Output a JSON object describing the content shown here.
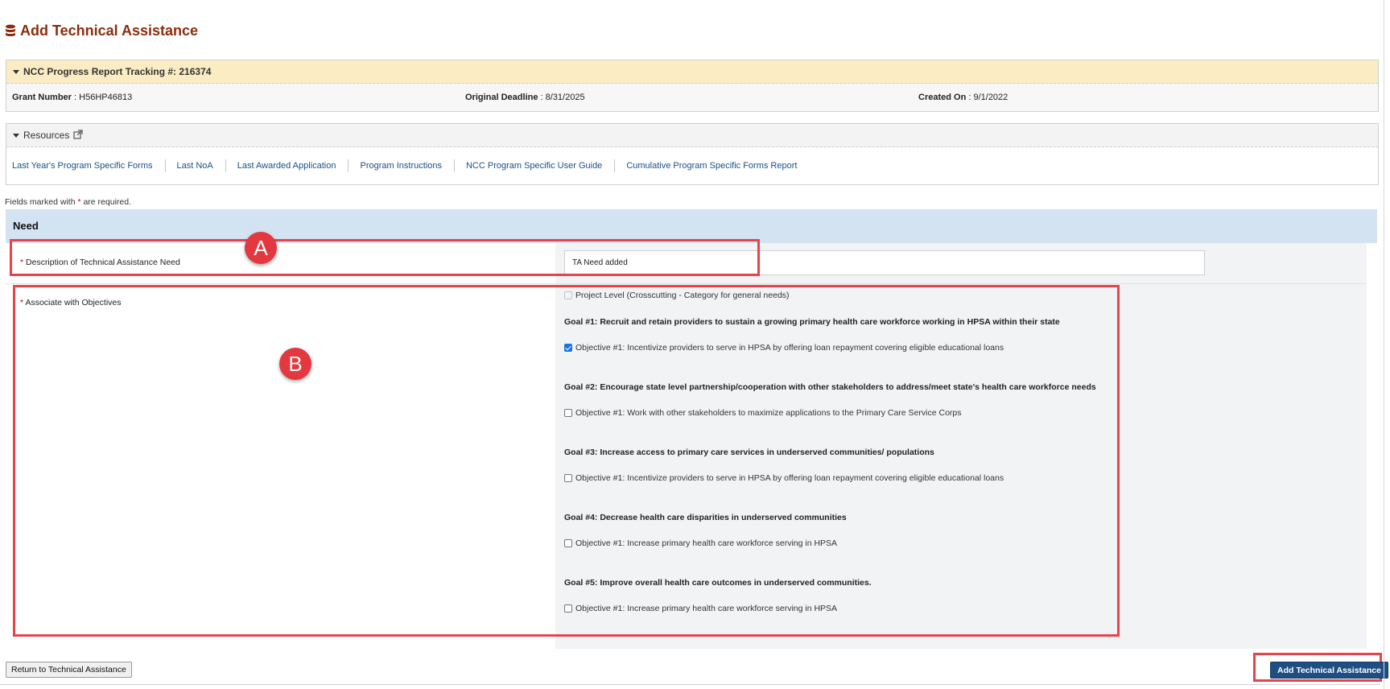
{
  "page": {
    "title": "Add Technical Assistance",
    "title_icon": "database-icon",
    "accent_color": "#8a2d0c"
  },
  "tracking": {
    "header": "NCC Progress Report Tracking #: 216374",
    "grant_label": "Grant Number",
    "grant_value": " : H56HP46813",
    "deadline_label": "Original Deadline",
    "deadline_value": " : 8/31/2025",
    "created_label": "Created On",
    "created_value": " : 9/1/2022"
  },
  "resources": {
    "header": "Resources",
    "header_icon": "external-link-icon",
    "links": [
      "Last Year's Program Specific Forms",
      "Last NoA",
      "Last Awarded Application",
      "Program Instructions",
      "NCC Program Specific User Guide",
      "Cumulative Program Specific Forms Report"
    ]
  },
  "form": {
    "required_note_pre": "Fields marked with ",
    "required_star": "*",
    "required_note_post": " are required.",
    "section_title": "Need",
    "description_label": "Description of Technical Assistance Need",
    "description_value": "TA Need added",
    "objectives_label": "Associate with Objectives",
    "project_level_label": "Project Level (Crosscutting - Category for general needs)",
    "goals": [
      {
        "title": "Goal #1: Recruit and retain providers to sustain a growing primary health care workforce working in HPSA within their state",
        "objective": "Objective #1: Incentivize providers to serve in HPSA by offering loan repayment covering eligible educational loans",
        "checked": true
      },
      {
        "title": "Goal #2: Encourage state level partnership/cooperation with other stakeholders to address/meet state's health care workforce needs",
        "objective": "Objective #1: Work with other stakeholders to maximize applications to the Primary Care Service Corps",
        "checked": false
      },
      {
        "title": "Goal #3: Increase access to primary care services in underserved communities/ populations",
        "objective": "Objective #1: Incentivize providers to serve in HPSA by offering loan repayment covering eligible educational loans",
        "checked": false
      },
      {
        "title": "Goal #4: Decrease health care disparities in underserved communities",
        "objective": "Objective #1: Increase primary health care workforce serving in HPSA",
        "checked": false
      },
      {
        "title": "Goal #5: Improve overall health care outcomes in underserved communities.",
        "objective": "Objective #1: Increase primary health care workforce serving in HPSA",
        "checked": false
      }
    ]
  },
  "buttons": {
    "return_label": "Return to Technical Assistance",
    "add_label": "Add Technical Assistance"
  },
  "annotations": {
    "a_label": "A",
    "b_label": "B",
    "color": "#e3383f"
  }
}
